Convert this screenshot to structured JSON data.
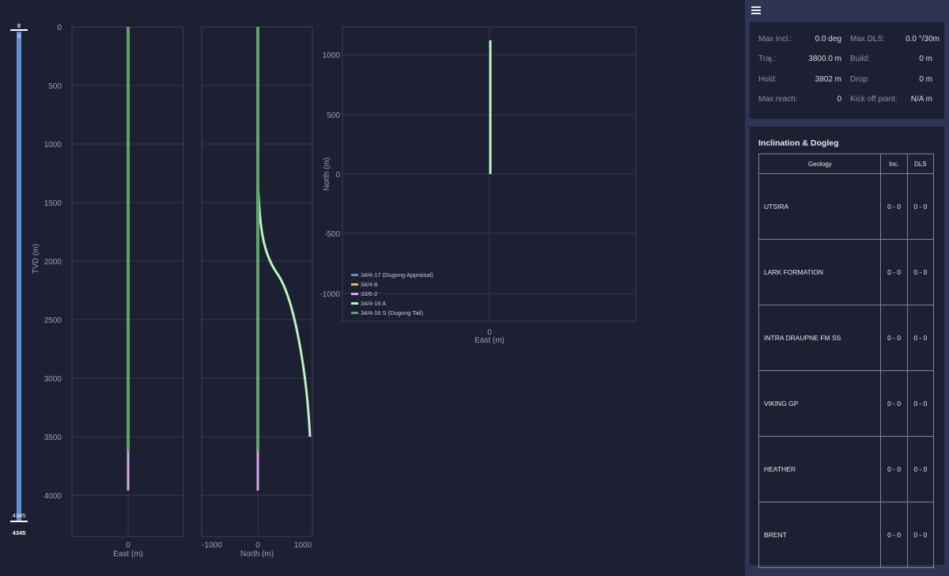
{
  "depth_track": {
    "top_label": "0",
    "top_value": "0",
    "bottom_label": "4345",
    "bottom_value": "4345"
  },
  "panel1": {
    "ylabel": "TVD (m)",
    "yticks": [
      "0",
      "500",
      "1000",
      "1500",
      "2000",
      "2500",
      "3000",
      "3500",
      "4000"
    ],
    "xlabel": "East (m)",
    "xticks": [
      "0"
    ]
  },
  "panel2": {
    "xlabel": "North (m)",
    "xticks": [
      "-1000",
      "0",
      "1000"
    ]
  },
  "plan_view": {
    "ylabel": "North (m)",
    "yticks": [
      "1000",
      "500",
      "0",
      "-500",
      "-1000"
    ],
    "xlabel": "East (m)",
    "xticks": [
      "0"
    ]
  },
  "legend": [
    {
      "label": "34/4-17 (Dugong Appraisal)",
      "color": "#5b8fd6"
    },
    {
      "label": "34/4-8",
      "color": "#d6c24a"
    },
    {
      "label": "33/6-2",
      "color": "#d9a6e8"
    },
    {
      "label": "34/4-16 A",
      "color": "#b9f5c0"
    },
    {
      "label": "34/4-16 S (Dugong Tail)",
      "color": "#5aa860"
    }
  ],
  "menu": {
    "icon": "hamburger-menu-icon"
  },
  "stats": {
    "max_incl_label": "Max Incl.:",
    "max_incl_value": "0.0 deg",
    "max_dls_label": "Max DLS:",
    "max_dls_value": "0.0 °/30m",
    "traj_label": "Traj.:",
    "traj_value": "3800.0 m",
    "build_label": "Build:",
    "build_value": "0 m",
    "hold_label": "Hold:",
    "hold_value": "3802 m",
    "drop_label": "Drop:",
    "drop_value": "0 m",
    "max_reach_label": "Max reach:",
    "max_reach_value": "0",
    "kick_off_label": "Kick off point:",
    "kick_off_value": "N/A m"
  },
  "inclination": {
    "title": "Inclination & Dogleg",
    "headers": {
      "geology": "Geology",
      "inc": "Inc.",
      "dls": "DLS"
    },
    "rows": [
      {
        "name": "UTSIRA",
        "inc": "0 - 0",
        "dls": "0 - 0"
      },
      {
        "name": "LARK FORMATION",
        "inc": "0 - 0",
        "dls": "0 - 0"
      },
      {
        "name": "INTRA DRAUPNE FM SS",
        "inc": "0 - 0",
        "dls": "0 - 0"
      },
      {
        "name": "VIKING GP",
        "inc": "0 - 0",
        "dls": "0 - 0"
      },
      {
        "name": "HEATHER",
        "inc": "0 - 0",
        "dls": "0 - 0"
      },
      {
        "name": "BRENT",
        "inc": "0 - 0",
        "dls": "0 - 0"
      }
    ]
  }
}
